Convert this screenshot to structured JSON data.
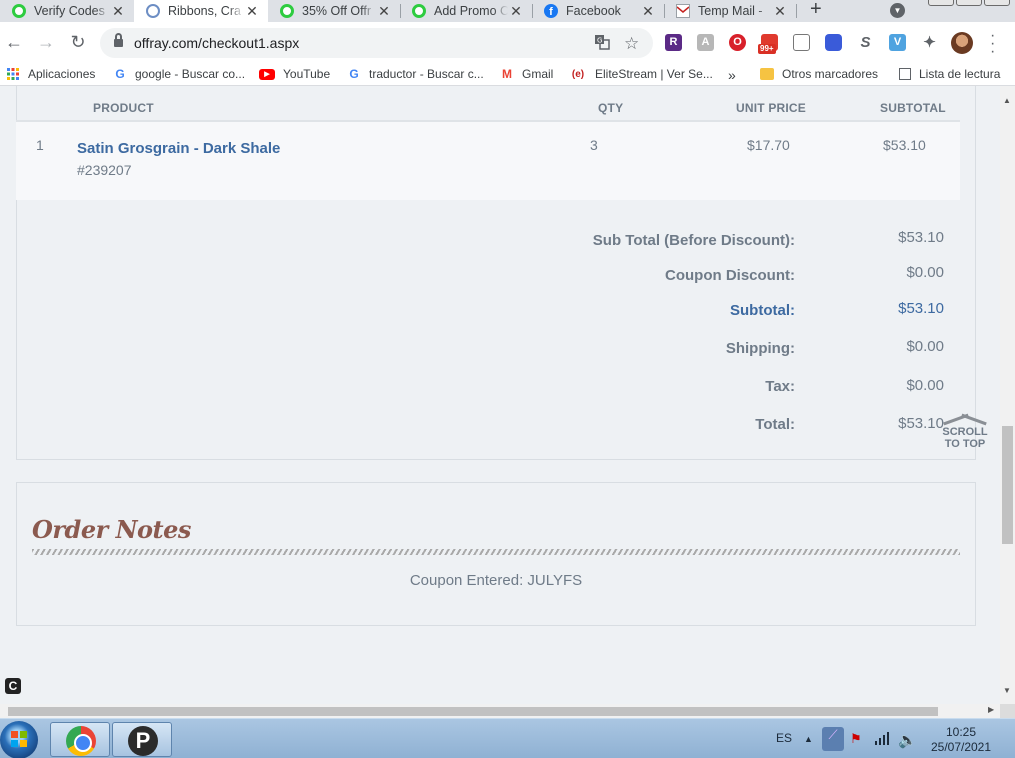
{
  "browser": {
    "tabs": [
      {
        "title": "Verify Codes",
        "icon": "green-circle-icon",
        "active": false
      },
      {
        "title": "Ribbons, Cra",
        "icon": "loading-ring-icon",
        "active": true
      },
      {
        "title": "35% Off Offr",
        "icon": "green-circle-icon",
        "active": false
      },
      {
        "title": "Add Promo C",
        "icon": "green-circle-icon",
        "active": false
      },
      {
        "title": "Facebook",
        "icon": "facebook-icon",
        "active": false
      },
      {
        "title": "Temp Mail -",
        "icon": "mail-icon",
        "active": false
      }
    ],
    "new_tab": "+",
    "url": "offray.com/checkout1.aspx",
    "extensions": [
      "R",
      "A",
      "O",
      "",
      "",
      "",
      "S",
      "V"
    ],
    "extension_badge": "99+",
    "bookmarks": [
      {
        "label": "Aplicaciones",
        "icon": "apps-grid-icon"
      },
      {
        "label": "google - Buscar co...",
        "icon": "google-icon"
      },
      {
        "label": "YouTube",
        "icon": "youtube-icon"
      },
      {
        "label": "traductor - Buscar c...",
        "icon": "google-icon"
      },
      {
        "label": "Gmail",
        "icon": "gmail-icon"
      },
      {
        "label": "EliteStream | Ver Se...",
        "icon": "elitestream-icon"
      }
    ],
    "bookmarks_more": "»",
    "other_bookmarks": "Otros marcadores",
    "reading_list": "Lista de lectura"
  },
  "order": {
    "columns": {
      "product": "PRODUCT",
      "qty": "QTY",
      "unit_price": "UNIT PRICE",
      "subtotal": "SUBTOTAL"
    },
    "items": [
      {
        "index": "1",
        "name": "Satin Grosgrain - Dark Shale",
        "sku": "#239207",
        "qty": "3",
        "unit_price": "$17.70",
        "subtotal": "$53.10"
      }
    ],
    "totals": {
      "sub_total_before_label": "Sub Total (Before Discount):",
      "sub_total_before": "$53.10",
      "coupon_label": "Coupon Discount:",
      "coupon": "$0.00",
      "subtotal_label": "Subtotal:",
      "subtotal": "$53.10",
      "shipping_label": "Shipping:",
      "shipping": "$0.00",
      "tax_label": "Tax:",
      "tax": "$0.00",
      "total_label": "Total:",
      "total": "$53.10"
    },
    "scroll_to_top": [
      "SCROLL",
      "TO TOP"
    ]
  },
  "notes": {
    "title": "Order Notes",
    "text": "Coupon Entered: JULYFS"
  },
  "taskbar": {
    "language": "ES",
    "time": "10:25",
    "date": "25/07/2021"
  },
  "colors": {
    "accent_blue": "#3d6aa1",
    "notes_title": "#8b5a4f",
    "text_gray": "#6f7b88"
  }
}
